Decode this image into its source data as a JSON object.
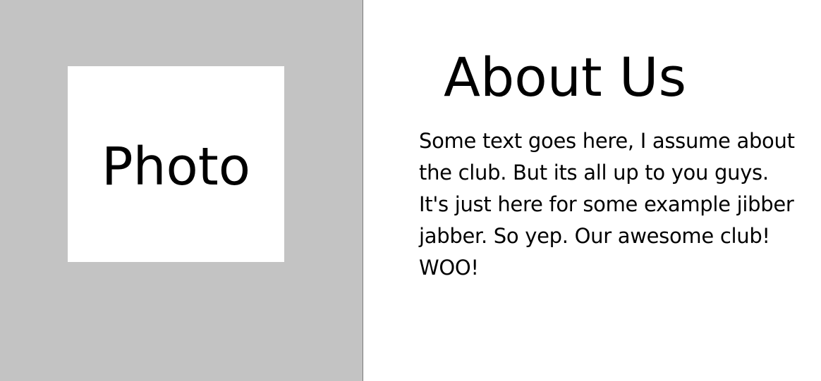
{
  "photo": {
    "label": "Photo"
  },
  "about": {
    "title": "About Us",
    "body": "Some text goes here, I assume about the club. But its all up to you guys. It's just here for some example jibber jabber. So yep. Our awesome club! WOO!"
  },
  "colors": {
    "left_panel_background": "#c3c3c3",
    "photo_background": "#ffffff",
    "right_panel_background": "#ffffff",
    "text": "#000000"
  }
}
